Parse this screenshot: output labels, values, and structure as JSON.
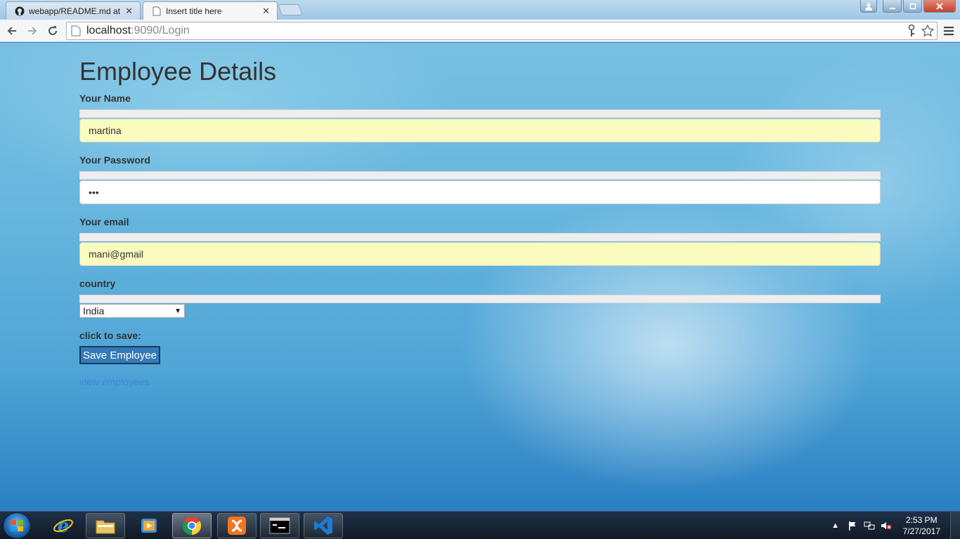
{
  "browser": {
    "tabs": [
      {
        "title": "webapp/README.md at m",
        "icon": "github-icon",
        "active": false
      },
      {
        "title": "Insert title here",
        "icon": "page-icon",
        "active": true
      }
    ],
    "address_bar": {
      "host": "localhost",
      "path": ":9090/Login"
    }
  },
  "page": {
    "title": "Employee Details",
    "fields": {
      "name": {
        "label": "Your Name",
        "value": "martina"
      },
      "password": {
        "label": "Your Password",
        "value": "•••"
      },
      "email": {
        "label": "Your email",
        "value": "mani@gmail"
      },
      "country": {
        "label": "country",
        "selected": "India"
      }
    },
    "save_label": "click to save:",
    "save_button": "Save Employee",
    "view_link": "view employees"
  },
  "taskbar": {
    "apps": [
      "internet-explorer-icon",
      "file-explorer-icon",
      "media-player-icon",
      "chrome-icon",
      "xampp-icon",
      "command-prompt-icon",
      "visual-studio-icon"
    ],
    "clock": {
      "time": "2:53 PM",
      "date": "7/27/2017"
    }
  },
  "colors": {
    "accent_button": "#337ab7",
    "autofill_bg": "#fafbbe",
    "link": "#3e8ad1"
  }
}
